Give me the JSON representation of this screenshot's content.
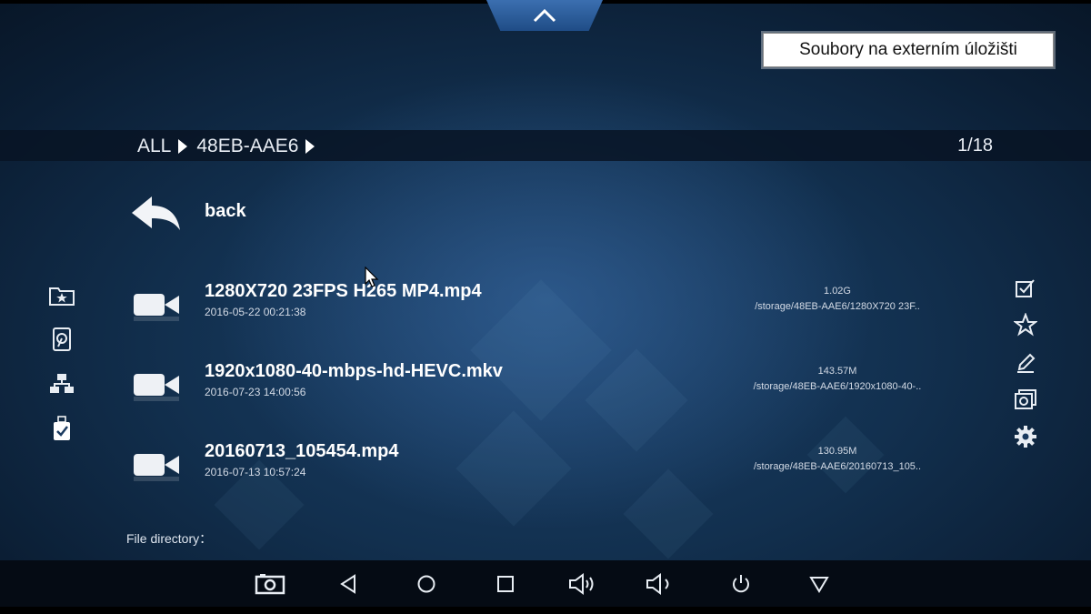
{
  "notice": "Soubory na externím úložišti",
  "breadcrumb": {
    "root": "ALL",
    "device": "48EB-AAE6",
    "page": "1/18"
  },
  "back": {
    "label": "back"
  },
  "files": [
    {
      "name": "1280X720 23FPS H265 MP4.mp4",
      "date": "2016-05-22 00:21:38",
      "size": "1.02G",
      "path": "/storage/48EB-AAE6/1280X720 23F..",
      "icon": "video-camera-icon"
    },
    {
      "name": "1920x1080-40-mbps-hd-HEVC.mkv",
      "date": "2016-07-23 14:00:56",
      "size": "143.57M",
      "path": "/storage/48EB-AAE6/1920x1080-40-..",
      "icon": "video-camera-icon"
    },
    {
      "name": "20160713_105454.mp4",
      "date": "2016-07-13 10:57:24",
      "size": "130.95M",
      "path": "/storage/48EB-AAE6/20160713_105..",
      "icon": "video-camera-icon"
    }
  ],
  "file_directory_label": "File directory：",
  "left_sidebar": [
    "favorite-folder-icon",
    "hard-disk-icon",
    "network-icon",
    "usb-drive-icon"
  ],
  "right_sidebar": [
    "select-all-icon",
    "star-icon",
    "edit-icon",
    "gallery-icon",
    "settings-gear-icon"
  ],
  "nav_bar": [
    "screenshot-icon",
    "back-triangle-icon",
    "home-circle-icon",
    "recents-square-icon",
    "volume-down-icon",
    "volume-up-icon",
    "power-icon",
    "menu-down-icon"
  ],
  "colors": {
    "background": "#12304f",
    "accent": "#2c5e9c",
    "text": "#ffffff"
  }
}
